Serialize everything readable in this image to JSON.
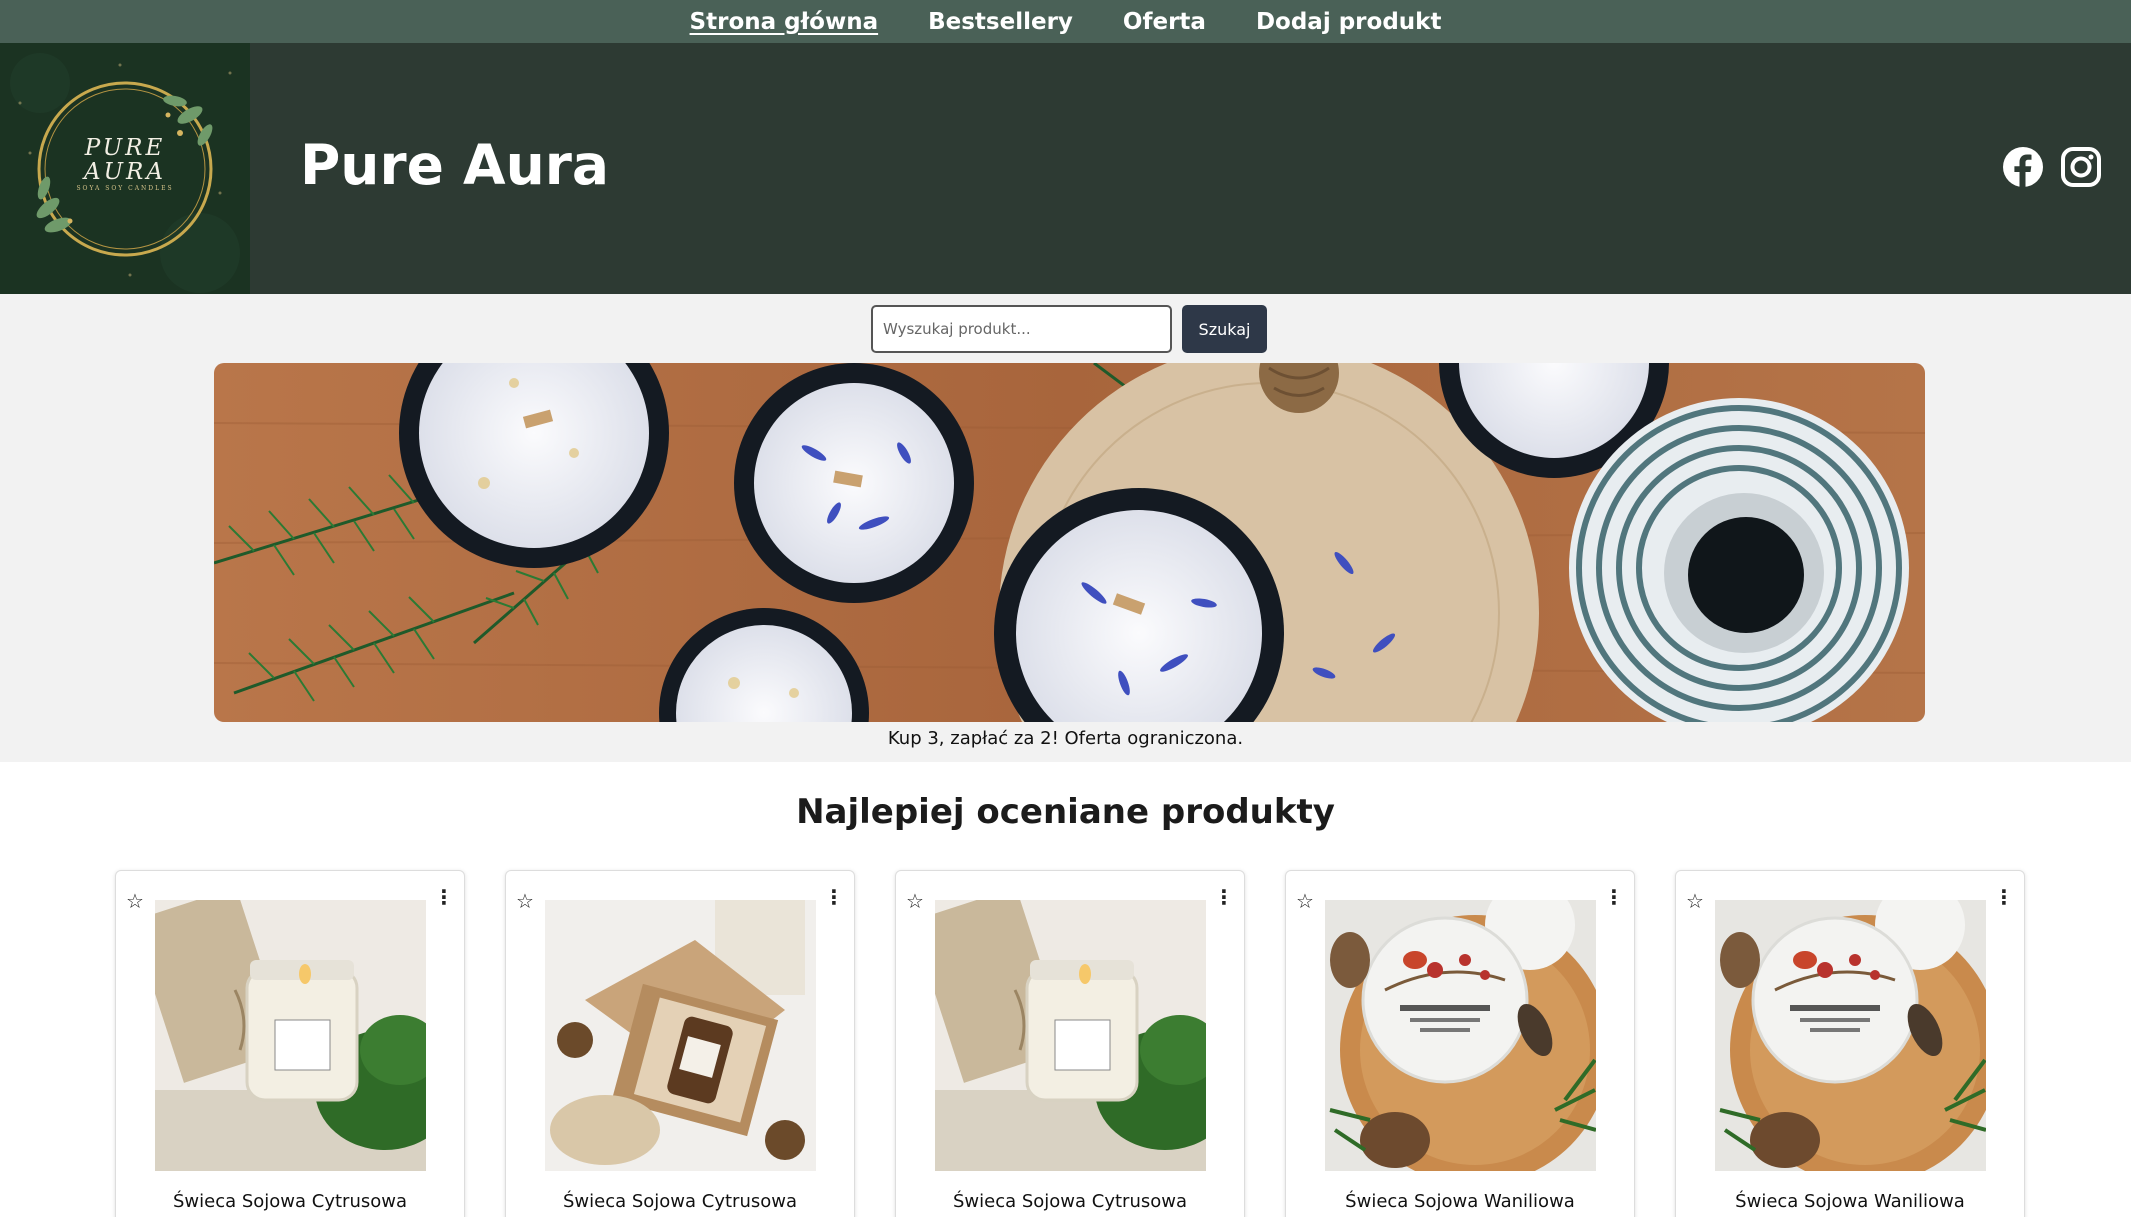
{
  "nav": {
    "items": [
      {
        "label": "Strona główna",
        "active": true
      },
      {
        "label": "Bestsellery",
        "active": false
      },
      {
        "label": "Oferta",
        "active": false
      },
      {
        "label": "Dodaj produkt",
        "active": false
      }
    ]
  },
  "header": {
    "logo_line1": "PURE",
    "logo_line2": "AURA",
    "logo_tagline": "SOYA SOY CANDLES",
    "title": "Pure Aura",
    "social": [
      "facebook-icon",
      "instagram-icon"
    ]
  },
  "search": {
    "placeholder": "Wyszukaj produkt...",
    "button_label": "Szukaj"
  },
  "banner": {
    "caption": "Kup 3, zapłać za 2! Oferta ograniczona."
  },
  "products": {
    "title": "Najlepiej oceniane produkty",
    "items": [
      {
        "name": "Świeca Sojowa Cytrusowa",
        "image": "jar-candle-moss"
      },
      {
        "name": "Świeca Sojowa Cytrusowa",
        "image": "gift-box-candle"
      },
      {
        "name": "Świeca Sojowa Cytrusowa",
        "image": "jar-candle-moss"
      },
      {
        "name": "Świeca Sojowa Waniliowa",
        "image": "christmas-candle-tray"
      },
      {
        "name": "Świeca Sojowa Waniliowa",
        "image": "christmas-candle-tray"
      }
    ]
  },
  "colors": {
    "nav_bg": "#4a6157",
    "header_bg": "#2d3a33",
    "button_bg": "#2e3848",
    "page_bg": "#f2f2f2"
  }
}
